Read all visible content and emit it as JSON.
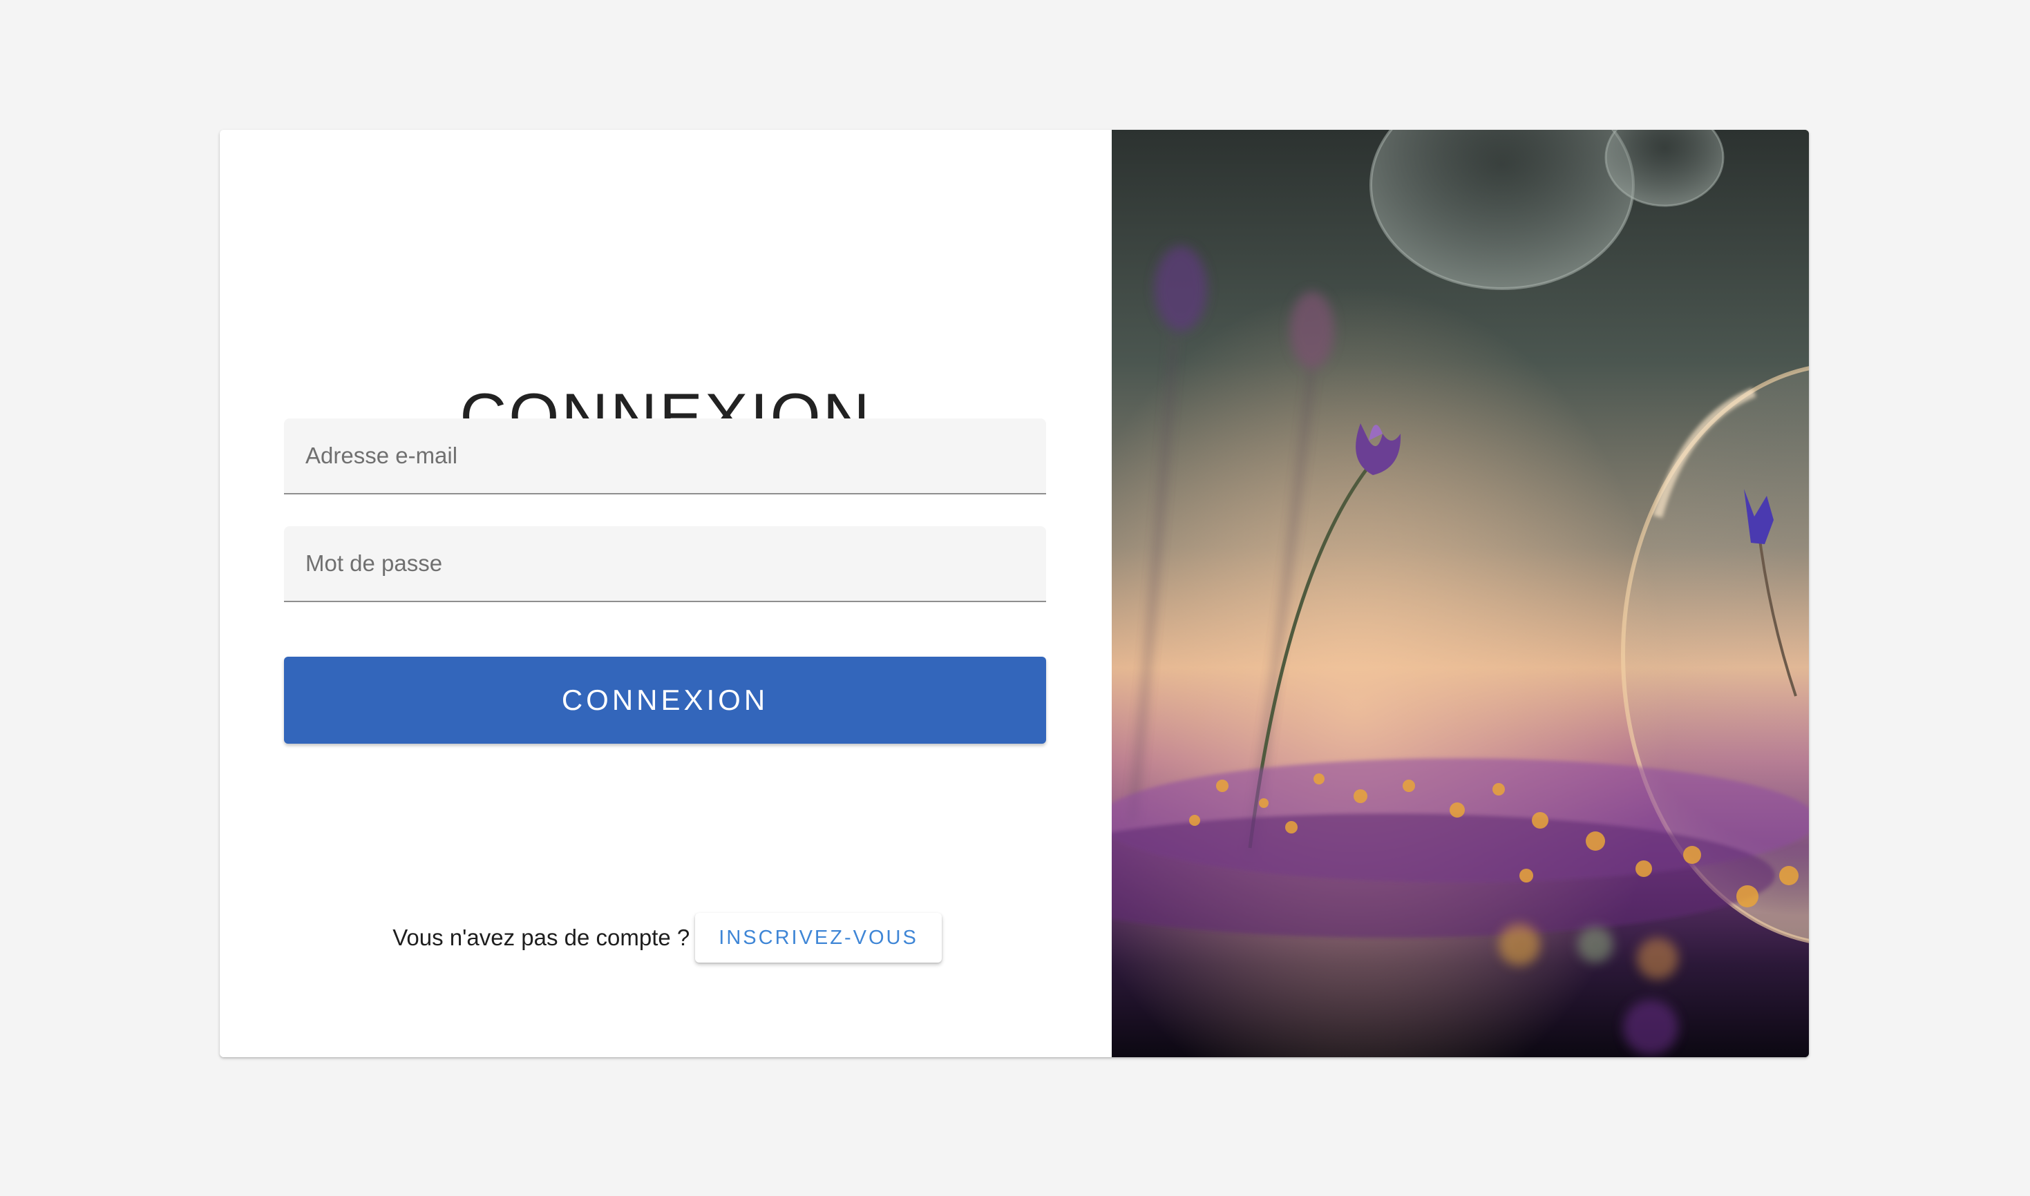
{
  "form": {
    "title": "CONNEXION",
    "email_placeholder": "Adresse e-mail",
    "password_placeholder": "Mot de passe",
    "submit_label": "CONNEXION"
  },
  "signup": {
    "prompt": "Vous n'avez pas de compte ?",
    "button_label": "INSCRIVEZ-VOUS"
  },
  "colors": {
    "primary": "#3366bb",
    "link": "#3f86d6",
    "background": "#f4f4f4"
  }
}
